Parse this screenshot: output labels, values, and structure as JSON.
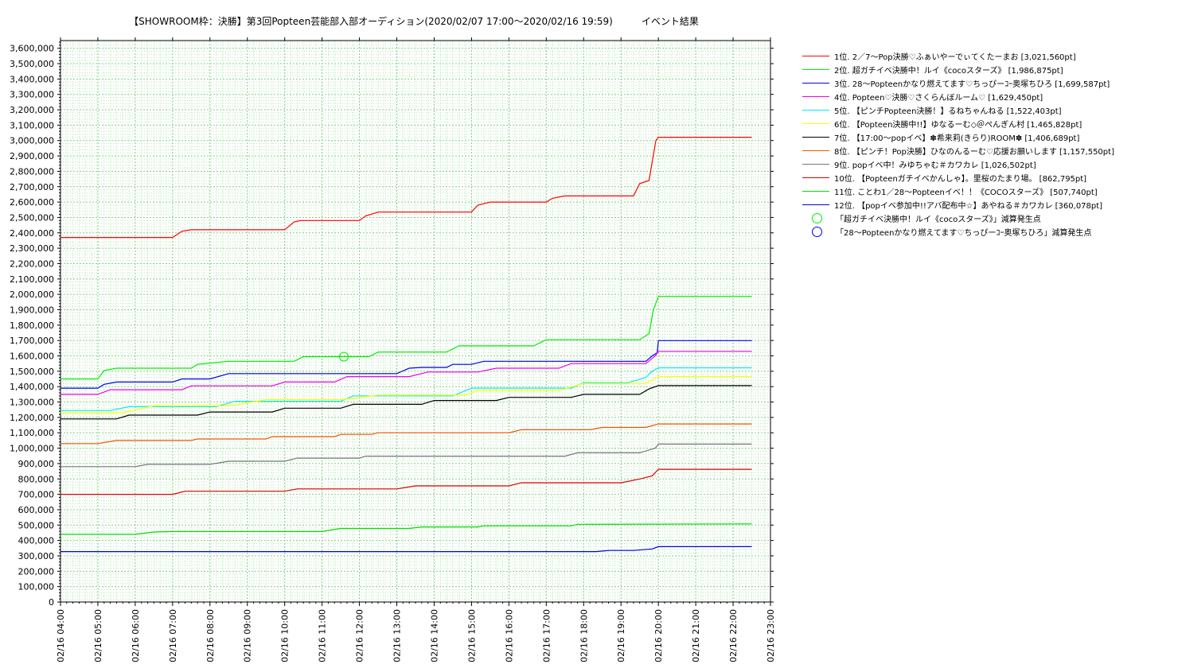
{
  "chart_data": {
    "type": "line",
    "title": "【SHOWROOM枠：決勝】第3回Popteen芸能部入部オーディション(2020/02/07 17:00～2020/02/16 19:59)　　　イベント結果",
    "ylim": [
      0,
      3650000
    ],
    "xlim": [
      "02/16 04:00",
      "02/16 23:00"
    ],
    "grid": true,
    "legend_position": "right",
    "y_ticks": [
      "0",
      "100,000",
      "200,000",
      "300,000",
      "400,000",
      "500,000",
      "600,000",
      "700,000",
      "800,000",
      "900,000",
      "1,000,000",
      "1,100,000",
      "1,200,000",
      "1,300,000",
      "1,400,000",
      "1,500,000",
      "1,600,000",
      "1,700,000",
      "1,800,000",
      "1,900,000",
      "2,000,000",
      "2,100,000",
      "2,200,000",
      "2,300,000",
      "2,400,000",
      "2,500,000",
      "2,600,000",
      "2,700,000",
      "2,800,000",
      "2,900,000",
      "3,000,000",
      "3,100,000",
      "3,200,000",
      "3,300,000",
      "3,400,000",
      "3,500,000",
      "3,600,000"
    ],
    "x_ticks": [
      "02/16 04:00",
      "02/16 05:00",
      "02/16 06:00",
      "02/16 07:00",
      "02/16 08:00",
      "02/16 09:00",
      "02/16 10:00",
      "02/16 11:00",
      "02/16 12:00",
      "02/16 13:00",
      "02/16 14:00",
      "02/16 15:00",
      "02/16 16:00",
      "02/16 17:00",
      "02/16 18:00",
      "02/16 19:00",
      "02/16 20:00",
      "02/16 21:00",
      "02/16 22:00",
      "02/16 23:00"
    ],
    "series": [
      {
        "name": "1位. 2／7〜Pop決勝♡ふぁいやーでぃてくたーまお [3,021,560pt]",
        "color": "#ff0000",
        "points": [
          [
            "04:00",
            2370000
          ],
          [
            "07:00",
            2370000
          ],
          [
            "07:15",
            2410000
          ],
          [
            "07:30",
            2420000
          ],
          [
            "10:00",
            2420000
          ],
          [
            "10:15",
            2470000
          ],
          [
            "10:25",
            2480000
          ],
          [
            "12:00",
            2480000
          ],
          [
            "12:10",
            2510000
          ],
          [
            "12:30",
            2535000
          ],
          [
            "15:00",
            2535000
          ],
          [
            "15:10",
            2580000
          ],
          [
            "15:30",
            2600000
          ],
          [
            "17:00",
            2600000
          ],
          [
            "17:10",
            2625000
          ],
          [
            "17:30",
            2640000
          ],
          [
            "19:20",
            2640000
          ],
          [
            "19:30",
            2720000
          ],
          [
            "19:45",
            2740000
          ],
          [
            "19:56",
            3000000
          ],
          [
            "20:00",
            3021560
          ],
          [
            "22:30",
            3021560
          ]
        ]
      },
      {
        "name": "2位. 超ガチイベ決勝中！ルイ《cocoスターズ》 [1,986,875pt]",
        "color": "#00ee00",
        "points": [
          [
            "04:00",
            1450000
          ],
          [
            "05:00",
            1450000
          ],
          [
            "05:10",
            1505000
          ],
          [
            "05:30",
            1520000
          ],
          [
            "07:30",
            1520000
          ],
          [
            "07:40",
            1545000
          ],
          [
            "08:30",
            1565000
          ],
          [
            "10:15",
            1565000
          ],
          [
            "10:30",
            1595000
          ],
          [
            "12:15",
            1595000
          ],
          [
            "12:30",
            1625000
          ],
          [
            "14:20",
            1625000
          ],
          [
            "14:40",
            1665000
          ],
          [
            "16:40",
            1665000
          ],
          [
            "17:00",
            1705000
          ],
          [
            "19:30",
            1705000
          ],
          [
            "19:45",
            1745000
          ],
          [
            "19:52",
            1900000
          ],
          [
            "20:00",
            1986875
          ],
          [
            "22:30",
            1986875
          ]
        ]
      },
      {
        "name": "3位. 28〜Popteenかなり燃えてます♡ちっぴーｺｰ奥塚ちひろ [1,699,587pt]",
        "color": "#0000ee",
        "points": [
          [
            "04:00",
            1390000
          ],
          [
            "05:00",
            1390000
          ],
          [
            "05:10",
            1415000
          ],
          [
            "05:30",
            1430000
          ],
          [
            "07:00",
            1430000
          ],
          [
            "07:15",
            1450000
          ],
          [
            "08:00",
            1450000
          ],
          [
            "08:30",
            1485000
          ],
          [
            "13:00",
            1485000
          ],
          [
            "13:20",
            1520000
          ],
          [
            "13:40",
            1525000
          ],
          [
            "14:20",
            1525000
          ],
          [
            "14:30",
            1545000
          ],
          [
            "15:00",
            1545000
          ],
          [
            "15:20",
            1565000
          ],
          [
            "19:40",
            1565000
          ],
          [
            "19:50",
            1600000
          ],
          [
            "19:58",
            1620000
          ],
          [
            "20:00",
            1699587
          ],
          [
            "22:30",
            1699587
          ]
        ]
      },
      {
        "name": "4位. Popteen♡決勝♡さくらんぼルーム♡ [1,629,450pt]",
        "color": "#ee00ee",
        "points": [
          [
            "04:00",
            1350000
          ],
          [
            "05:00",
            1350000
          ],
          [
            "05:20",
            1380000
          ],
          [
            "07:15",
            1380000
          ],
          [
            "07:30",
            1405000
          ],
          [
            "09:40",
            1405000
          ],
          [
            "10:00",
            1430000
          ],
          [
            "11:20",
            1430000
          ],
          [
            "11:40",
            1465000
          ],
          [
            "13:20",
            1465000
          ],
          [
            "13:50",
            1495000
          ],
          [
            "15:10",
            1495000
          ],
          [
            "15:40",
            1520000
          ],
          [
            "17:20",
            1520000
          ],
          [
            "17:40",
            1550000
          ],
          [
            "19:40",
            1550000
          ],
          [
            "19:55",
            1600000
          ],
          [
            "20:00",
            1629450
          ],
          [
            "22:30",
            1629450
          ]
        ]
      },
      {
        "name": "5位. 【ピンチPopteen決勝！】るねちゃんねる [1,522,403pt]",
        "color": "#00eeee",
        "points": [
          [
            "04:00",
            1245000
          ],
          [
            "05:20",
            1245000
          ],
          [
            "05:50",
            1270000
          ],
          [
            "08:10",
            1270000
          ],
          [
            "08:40",
            1305000
          ],
          [
            "11:30",
            1305000
          ],
          [
            "11:50",
            1340000
          ],
          [
            "14:30",
            1340000
          ],
          [
            "15:00",
            1390000
          ],
          [
            "17:40",
            1390000
          ],
          [
            "18:00",
            1425000
          ],
          [
            "19:10",
            1425000
          ],
          [
            "19:40",
            1460000
          ],
          [
            "19:50",
            1500000
          ],
          [
            "20:00",
            1522403
          ],
          [
            "22:30",
            1522403
          ]
        ]
      },
      {
        "name": "6位. 【Popteen決勝中!!】ゆなるーむ◇＠ぺんぎん村 [1,465,828pt]",
        "color": "#ffff00",
        "points": [
          [
            "04:00",
            1230000
          ],
          [
            "05:40",
            1230000
          ],
          [
            "06:30",
            1275000
          ],
          [
            "08:30",
            1275000
          ],
          [
            "09:00",
            1295000
          ],
          [
            "09:30",
            1315000
          ],
          [
            "11:30",
            1315000
          ],
          [
            "12:30",
            1345000
          ],
          [
            "14:50",
            1345000
          ],
          [
            "15:10",
            1375000
          ],
          [
            "17:20",
            1375000
          ],
          [
            "18:00",
            1420000
          ],
          [
            "19:40",
            1420000
          ],
          [
            "20:00",
            1465828
          ],
          [
            "22:30",
            1465828
          ]
        ]
      },
      {
        "name": "7位. 【17:00〜popイベ】✽希来莉(きらり)ROOM✽ [1,406,689pt]",
        "color": "#000000",
        "points": [
          [
            "04:00",
            1190000
          ],
          [
            "05:30",
            1190000
          ],
          [
            "05:50",
            1215000
          ],
          [
            "07:40",
            1215000
          ],
          [
            "08:00",
            1235000
          ],
          [
            "09:40",
            1235000
          ],
          [
            "10:00",
            1260000
          ],
          [
            "11:30",
            1260000
          ],
          [
            "11:50",
            1285000
          ],
          [
            "13:40",
            1285000
          ],
          [
            "14:00",
            1310000
          ],
          [
            "15:40",
            1310000
          ],
          [
            "16:00",
            1330000
          ],
          [
            "17:40",
            1330000
          ],
          [
            "18:00",
            1350000
          ],
          [
            "19:30",
            1350000
          ],
          [
            "19:45",
            1385000
          ],
          [
            "20:00",
            1406689
          ],
          [
            "22:30",
            1406689
          ]
        ]
      },
      {
        "name": "8位. 【ピンチ！Pop決勝】ひなのんるーむ♡応援お願いします [1,157,550pt]",
        "color": "#ee5500",
        "points": [
          [
            "04:00",
            1030000
          ],
          [
            "05:00",
            1030000
          ],
          [
            "05:30",
            1050000
          ],
          [
            "07:30",
            1050000
          ],
          [
            "07:40",
            1060000
          ],
          [
            "09:30",
            1060000
          ],
          [
            "09:40",
            1075000
          ],
          [
            "11:20",
            1075000
          ],
          [
            "11:30",
            1090000
          ],
          [
            "12:20",
            1090000
          ],
          [
            "12:30",
            1100000
          ],
          [
            "16:00",
            1100000
          ],
          [
            "16:20",
            1120000
          ],
          [
            "18:10",
            1120000
          ],
          [
            "18:30",
            1135000
          ],
          [
            "19:40",
            1135000
          ],
          [
            "20:00",
            1157550
          ],
          [
            "22:30",
            1157550
          ]
        ]
      },
      {
        "name": "9位. popイベ中！みゆちゃむ＃カワカレ [1,026,502pt]",
        "color": "#777777",
        "points": [
          [
            "04:00",
            880000
          ],
          [
            "06:00",
            880000
          ],
          [
            "06:20",
            895000
          ],
          [
            "08:00",
            895000
          ],
          [
            "08:30",
            915000
          ],
          [
            "10:00",
            915000
          ],
          [
            "10:20",
            935000
          ],
          [
            "12:00",
            935000
          ],
          [
            "12:10",
            948000
          ],
          [
            "17:30",
            948000
          ],
          [
            "17:50",
            970000
          ],
          [
            "19:30",
            970000
          ],
          [
            "19:55",
            1000000
          ],
          [
            "20:00",
            1026502
          ],
          [
            "22:30",
            1026502
          ]
        ]
      },
      {
        "name": "10位. 【Popteenガチイベかんしゃ】。里桜のたまり場。 [862,795pt]",
        "color": "#dd0000",
        "points": [
          [
            "04:00",
            700000
          ],
          [
            "07:00",
            700000
          ],
          [
            "07:20",
            720000
          ],
          [
            "10:00",
            720000
          ],
          [
            "10:20",
            735000
          ],
          [
            "13:00",
            735000
          ],
          [
            "13:30",
            755000
          ],
          [
            "16:00",
            755000
          ],
          [
            "16:20",
            775000
          ],
          [
            "19:00",
            775000
          ],
          [
            "19:30",
            800000
          ],
          [
            "19:50",
            820000
          ],
          [
            "20:00",
            862795
          ],
          [
            "22:30",
            862795
          ]
        ]
      },
      {
        "name": "11位. ことわ1／28〜Popteenイベ！！《COCOスターズ》 [507,740pt]",
        "color": "#00dd00",
        "points": [
          [
            "04:00",
            440000
          ],
          [
            "06:00",
            440000
          ],
          [
            "06:30",
            455000
          ],
          [
            "07:00",
            458000
          ],
          [
            "11:00",
            458000
          ],
          [
            "11:30",
            478000
          ],
          [
            "13:20",
            478000
          ],
          [
            "13:40",
            488000
          ],
          [
            "15:10",
            488000
          ],
          [
            "15:20",
            495000
          ],
          [
            "17:40",
            495000
          ],
          [
            "17:50",
            505000
          ],
          [
            "22:30",
            507740
          ]
        ]
      },
      {
        "name": "12位. 【popイベ参加中!!アバ配布中☆】あやねる＃カワカレ [360,078pt]",
        "color": "#0000dd",
        "points": [
          [
            "04:00",
            328000
          ],
          [
            "18:20",
            328000
          ],
          [
            "18:40",
            335000
          ],
          [
            "19:20",
            335000
          ],
          [
            "19:50",
            345000
          ],
          [
            "20:00",
            360078
          ],
          [
            "22:30",
            360078
          ]
        ]
      }
    ],
    "markers": [
      {
        "name": "「超ガチイベ決勝中！ルイ《cocoスターズ》」減算発生点",
        "color": "#00ee00",
        "points": [
          [
            "11:35",
            1595000
          ]
        ]
      },
      {
        "name": "「28〜Popteenかなり燃えてます♡ちっぴーｺｰ奥塚ちひろ」減算発生点",
        "color": "#0000ee",
        "points": []
      }
    ]
  }
}
